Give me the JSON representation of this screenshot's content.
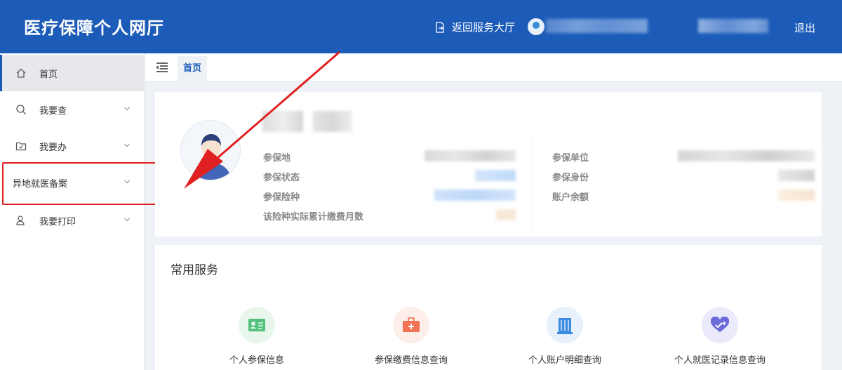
{
  "header": {
    "title": "医疗保障个人网厅",
    "back_label": "返回服务大厅",
    "logout_label": "退出"
  },
  "sidebar": {
    "items": [
      {
        "label": "首页",
        "icon": "home-icon"
      },
      {
        "label": "我要查",
        "icon": "search-icon"
      },
      {
        "label": "我要办",
        "icon": "folder-check-icon"
      },
      {
        "label": "异地就医备案",
        "icon": ""
      },
      {
        "label": "我要打印",
        "icon": "user-print-icon"
      }
    ]
  },
  "tabs": {
    "home_label": "首页"
  },
  "profile": {
    "labels": {
      "insured_place": "参保地",
      "insured_status": "参保状态",
      "insurance_type": "参保险种",
      "paid_months": "该险种实际累计缴费月数",
      "insured_unit": "参保单位",
      "insured_identity": "参保身份",
      "account_balance": "账户余额"
    }
  },
  "services": {
    "title": "常用服务",
    "items": [
      {
        "label": "个人参保信息",
        "icon": "id-card-icon",
        "color": "#e8f6ec",
        "accent": "#52c27a"
      },
      {
        "label": "参保缴费信息查询",
        "icon": "medical-kit-icon",
        "color": "#fdeee9",
        "accent": "#f07355"
      },
      {
        "label": "个人账户明细查询",
        "icon": "building-icon",
        "color": "#e6f1fc",
        "accent": "#3c8be0"
      },
      {
        "label": "个人就医记录信息查询",
        "icon": "heart-plus-icon",
        "color": "#ebeafb",
        "accent": "#6c6bd9"
      }
    ]
  },
  "colors": {
    "header_bg": "#1c5cb8",
    "annotation_red": "#e02020"
  }
}
